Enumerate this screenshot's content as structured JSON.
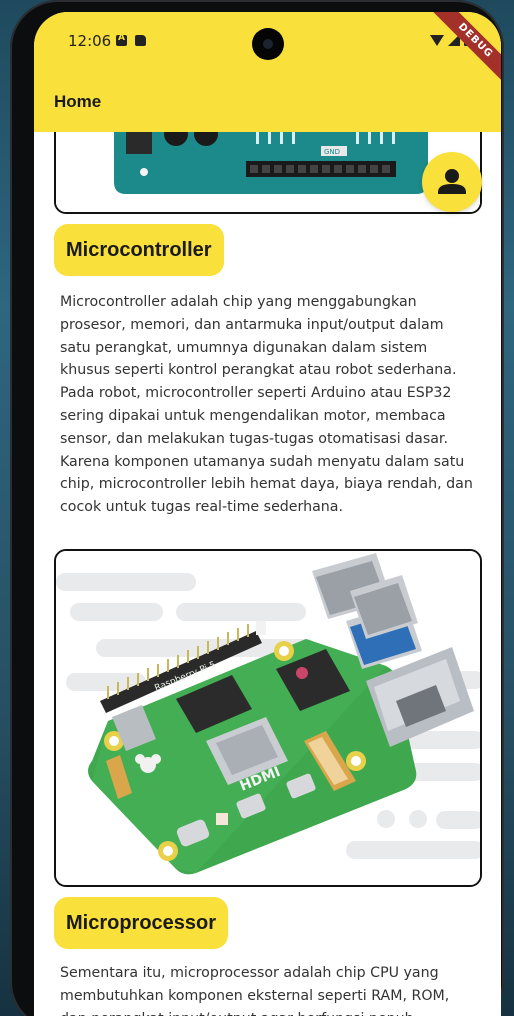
{
  "status_bar": {
    "time": "12:06",
    "debug_label": "DEBUG"
  },
  "app_bar": {
    "title": "Home"
  },
  "sections": [
    {
      "heading": "Microcontroller",
      "image_alt": "arduino-board",
      "text": "Microcontroller adalah chip yang menggabungkan prosesor, memori, dan antarmuka input/output dalam satu perangkat, umumnya digunakan dalam sistem khusus seperti kontrol perangkat atau robot sederhana. Pada robot, microcontroller seperti Arduino atau ESP32 sering dipakai untuk mengendalikan motor, membaca sensor, dan melakukan tugas-tugas otomatisasi dasar. Karena komponen utamanya sudah menyatu dalam satu chip, microcontroller lebih hemat daya, biaya rendah, dan cocok untuk tugas real-time sederhana."
    },
    {
      "heading": "Microprocessor",
      "image_alt": "raspberry-pi-board",
      "board_labels": {
        "brand": "Raspberry Pi 5",
        "hdmi": "HDMI"
      },
      "text": "Sementara itu, microprocessor adalah chip CPU yang membutuhkan komponen eksternal seperti RAM, ROM, dan perangkat input/output agar berfungsi penuh."
    }
  ],
  "board1_labels": {
    "gnd": "GND"
  },
  "icons": {
    "fab": "person-icon"
  },
  "colors": {
    "accent": "#f9e03a",
    "debug": "#a3312a"
  }
}
